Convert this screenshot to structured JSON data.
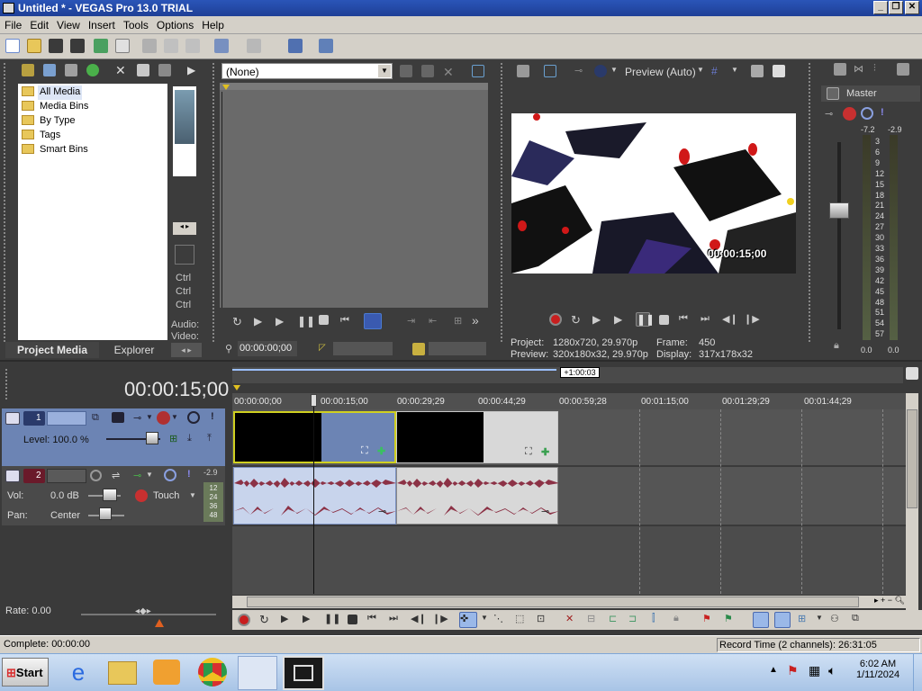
{
  "window": {
    "title": "Untitled * - VEGAS Pro 13.0 TRIAL",
    "controls": [
      "_",
      "❐",
      "✕"
    ]
  },
  "menu": [
    "File",
    "Edit",
    "View",
    "Insert",
    "Tools",
    "Options",
    "Help"
  ],
  "project_media": {
    "tree": [
      "All Media",
      "Media Bins",
      "By Type",
      "Tags",
      "Smart Bins"
    ],
    "expand_symbol": "+",
    "side_labels": [
      "Ctrl",
      "Ctrl",
      "Ctrl",
      "Audio:",
      "Video:"
    ],
    "tabs": [
      "Project Media",
      "Explorer"
    ]
  },
  "trimmer": {
    "dropdown_value": "(None)",
    "time": "00:00:00;00"
  },
  "preview": {
    "quality": "Preview (Auto)",
    "overlay_time": "00:00:15;00",
    "project_label": "Project:",
    "project_value": "1280x720, 29.970p",
    "preview_label": "Preview:",
    "preview_value": "320x180x32, 29.970p",
    "frame_label": "Frame:",
    "frame_value": "450",
    "display_label": "Display:",
    "display_value": "317x178x32"
  },
  "master": {
    "label": "Master",
    "peak_left": "-7.2",
    "peak_right": "-2.9",
    "scale": [
      "3",
      "6",
      "9",
      "12",
      "15",
      "18",
      "21",
      "24",
      "27",
      "30",
      "33",
      "36",
      "39",
      "42",
      "45",
      "48",
      "51",
      "54",
      "57"
    ],
    "bottom_left": "0.0",
    "bottom_right": "0.0"
  },
  "timeline": {
    "cursor_time": "00:00:15;00",
    "loop_label": "+1:00:03",
    "ruler": [
      "00:00:00;00",
      "00:00:15;00",
      "00:00:29;29",
      "00:00:44;29",
      "00:00:59;28",
      "00:01:15;00",
      "00:01:29;29",
      "00:01:44;29"
    ],
    "track1": {
      "number": "1",
      "level_label": "Level: 100.0 %"
    },
    "track2": {
      "number": "2",
      "vol_label": "Vol:",
      "vol_value": "0.0 dB",
      "pan_label": "Pan:",
      "pan_value": "Center",
      "mode": "Touch",
      "peak": "-2.9",
      "meter_scale": [
        "12",
        "24",
        "36",
        "48"
      ]
    },
    "rate_label": "Rate: 0.00"
  },
  "status": {
    "left": "Complete: 00:00:00",
    "right": "Record Time (2 channels): 26:31:05"
  },
  "taskbar": {
    "start": "Start",
    "time": "6:02 AM",
    "date": "1/11/2024"
  },
  "colors": {
    "title_bar": "#1e3f96",
    "panel_dark": "#3c3c3c",
    "video_track": "#6c84b4",
    "audio_wave": "#8c3246",
    "accent_red": "#c81e1e"
  }
}
